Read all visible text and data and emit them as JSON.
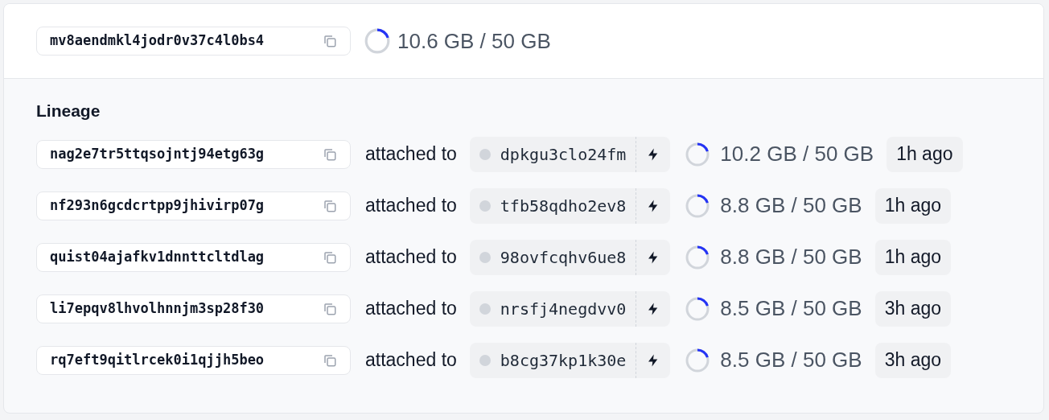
{
  "volume": {
    "id": "mv8aendmkl4jodr0v37c4l0bs4",
    "usage": "10.6 GB / 50 GB"
  },
  "lineage": {
    "title": "Lineage",
    "rows": [
      {
        "id": "nag2e7tr5ttqsojntj94etg63g",
        "relation": "attached to",
        "machine": "dpkgu3clo24fm",
        "usage": "10.2 GB / 50 GB",
        "age": "1h ago"
      },
      {
        "id": "nf293n6gcdcrtpp9jhivirp07g",
        "relation": "attached to",
        "machine": "tfb58qdho2ev8",
        "usage": "8.8 GB / 50 GB",
        "age": "1h ago"
      },
      {
        "id": "quist04ajafkv1dnnttcltdlag",
        "relation": "attached to",
        "machine": "98ovfcqhv6ue8",
        "usage": "8.8 GB / 50 GB",
        "age": "1h ago"
      },
      {
        "id": "li7epqv8lhvolhnnjm3sp28f30",
        "relation": "attached to",
        "machine": "nrsfj4negdvv0",
        "usage": "8.5 GB / 50 GB",
        "age": "3h ago"
      },
      {
        "id": "rq7eft9qitlrcek0i1qjjh5beo",
        "relation": "attached to",
        "machine": "b8cg37kp1k30e",
        "usage": "8.5 GB / 50 GB",
        "age": "3h ago"
      }
    ]
  }
}
